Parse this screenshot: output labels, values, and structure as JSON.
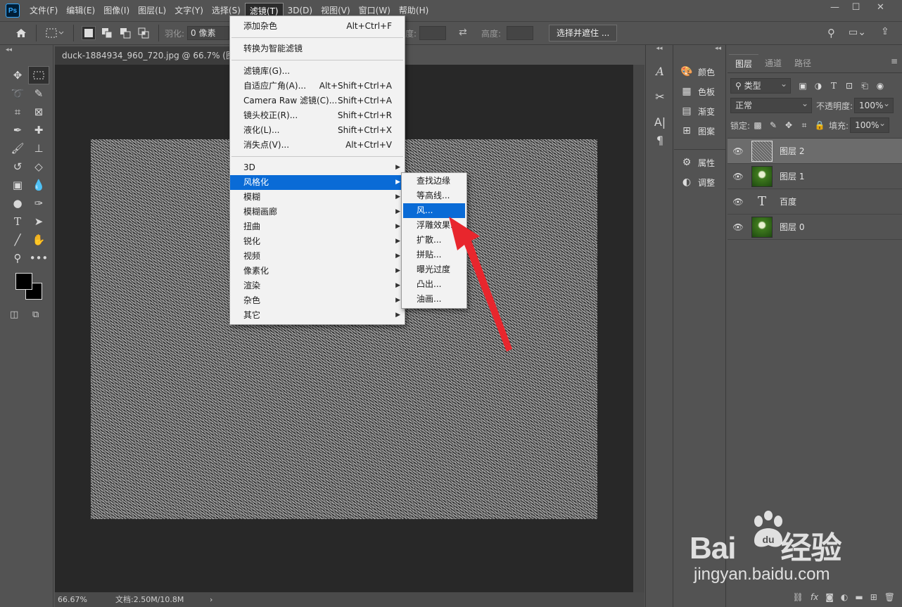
{
  "menubar": {
    "app_logo": "Ps",
    "items": [
      "文件(F)",
      "编辑(E)",
      "图像(I)",
      "图层(L)",
      "文字(Y)",
      "选择(S)",
      "滤镜(T)",
      "3D(D)",
      "视图(V)",
      "窗口(W)",
      "帮助(H)"
    ],
    "active_index": 6
  },
  "options_bar": {
    "feather_label": "羽化:",
    "feather_value": "0 像素",
    "width_label_fragment": "度:",
    "height_label": "高度:",
    "select_mask_button": "选择并遮住 ..."
  },
  "document": {
    "tab_title": "duck-1884934_960_720.jpg @ 66.7% (图层 2,",
    "zoom": "66.67%",
    "doc_info": "文档:2.50M/10.8M"
  },
  "filter_menu": {
    "items": [
      {
        "label": "添加杂色",
        "shortcut": "Alt+Ctrl+F"
      },
      {
        "sep": true
      },
      {
        "label": "转换为智能滤镜",
        "shortcut": ""
      },
      {
        "sep": true
      },
      {
        "label": "滤镜库(G)...",
        "shortcut": ""
      },
      {
        "label": "自适应广角(A)...",
        "shortcut": "Alt+Shift+Ctrl+A"
      },
      {
        "label": "Camera Raw 滤镜(C)...",
        "shortcut": "Shift+Ctrl+A"
      },
      {
        "label": "镜头校正(R)...",
        "shortcut": "Shift+Ctrl+R"
      },
      {
        "label": "液化(L)...",
        "shortcut": "Shift+Ctrl+X"
      },
      {
        "label": "消失点(V)...",
        "shortcut": "Alt+Ctrl+V"
      },
      {
        "sep": true
      },
      {
        "label": "3D",
        "submenu": true
      },
      {
        "label": "风格化",
        "submenu": true,
        "highlight": true
      },
      {
        "label": "模糊",
        "submenu": true
      },
      {
        "label": "模糊画廊",
        "submenu": true
      },
      {
        "label": "扭曲",
        "submenu": true
      },
      {
        "label": "锐化",
        "submenu": true
      },
      {
        "label": "视频",
        "submenu": true
      },
      {
        "label": "像素化",
        "submenu": true
      },
      {
        "label": "渲染",
        "submenu": true
      },
      {
        "label": "杂色",
        "submenu": true
      },
      {
        "label": "其它",
        "submenu": true
      }
    ]
  },
  "stylize_submenu": {
    "items": [
      "查找边缘",
      "等高线...",
      "风...",
      "浮雕效果...",
      "扩散...",
      "拼贴...",
      "曝光过度",
      "凸出...",
      "油画..."
    ],
    "highlight_index": 2
  },
  "side_panels": {
    "items": [
      "颜色",
      "色板",
      "渐变",
      "图案",
      "属性",
      "调整"
    ]
  },
  "layers_panel": {
    "tabs": [
      "图层",
      "通道",
      "路径"
    ],
    "filter_kind": "类型",
    "blend_mode": "正常",
    "opacity_label": "不透明度:",
    "opacity_value": "100%",
    "lock_label": "锁定:",
    "fill_label": "填充:",
    "fill_value": "100%",
    "layers": [
      {
        "name": "图层 2",
        "thumb": "noise",
        "selected": true
      },
      {
        "name": "图层 1",
        "thumb": "photo",
        "selected": false
      },
      {
        "name": "百度",
        "thumb": "text",
        "selected": false
      },
      {
        "name": "图层 0",
        "thumb": "photo",
        "selected": false
      }
    ]
  },
  "watermark": {
    "logo_a": "Bai",
    "logo_b": "经验",
    "domain": "jingyan.baidu.com"
  },
  "colors": {
    "menu_highlight": "#0a6bd6",
    "annotation_arrow": "#e8262d",
    "ui_background": "#535353"
  }
}
